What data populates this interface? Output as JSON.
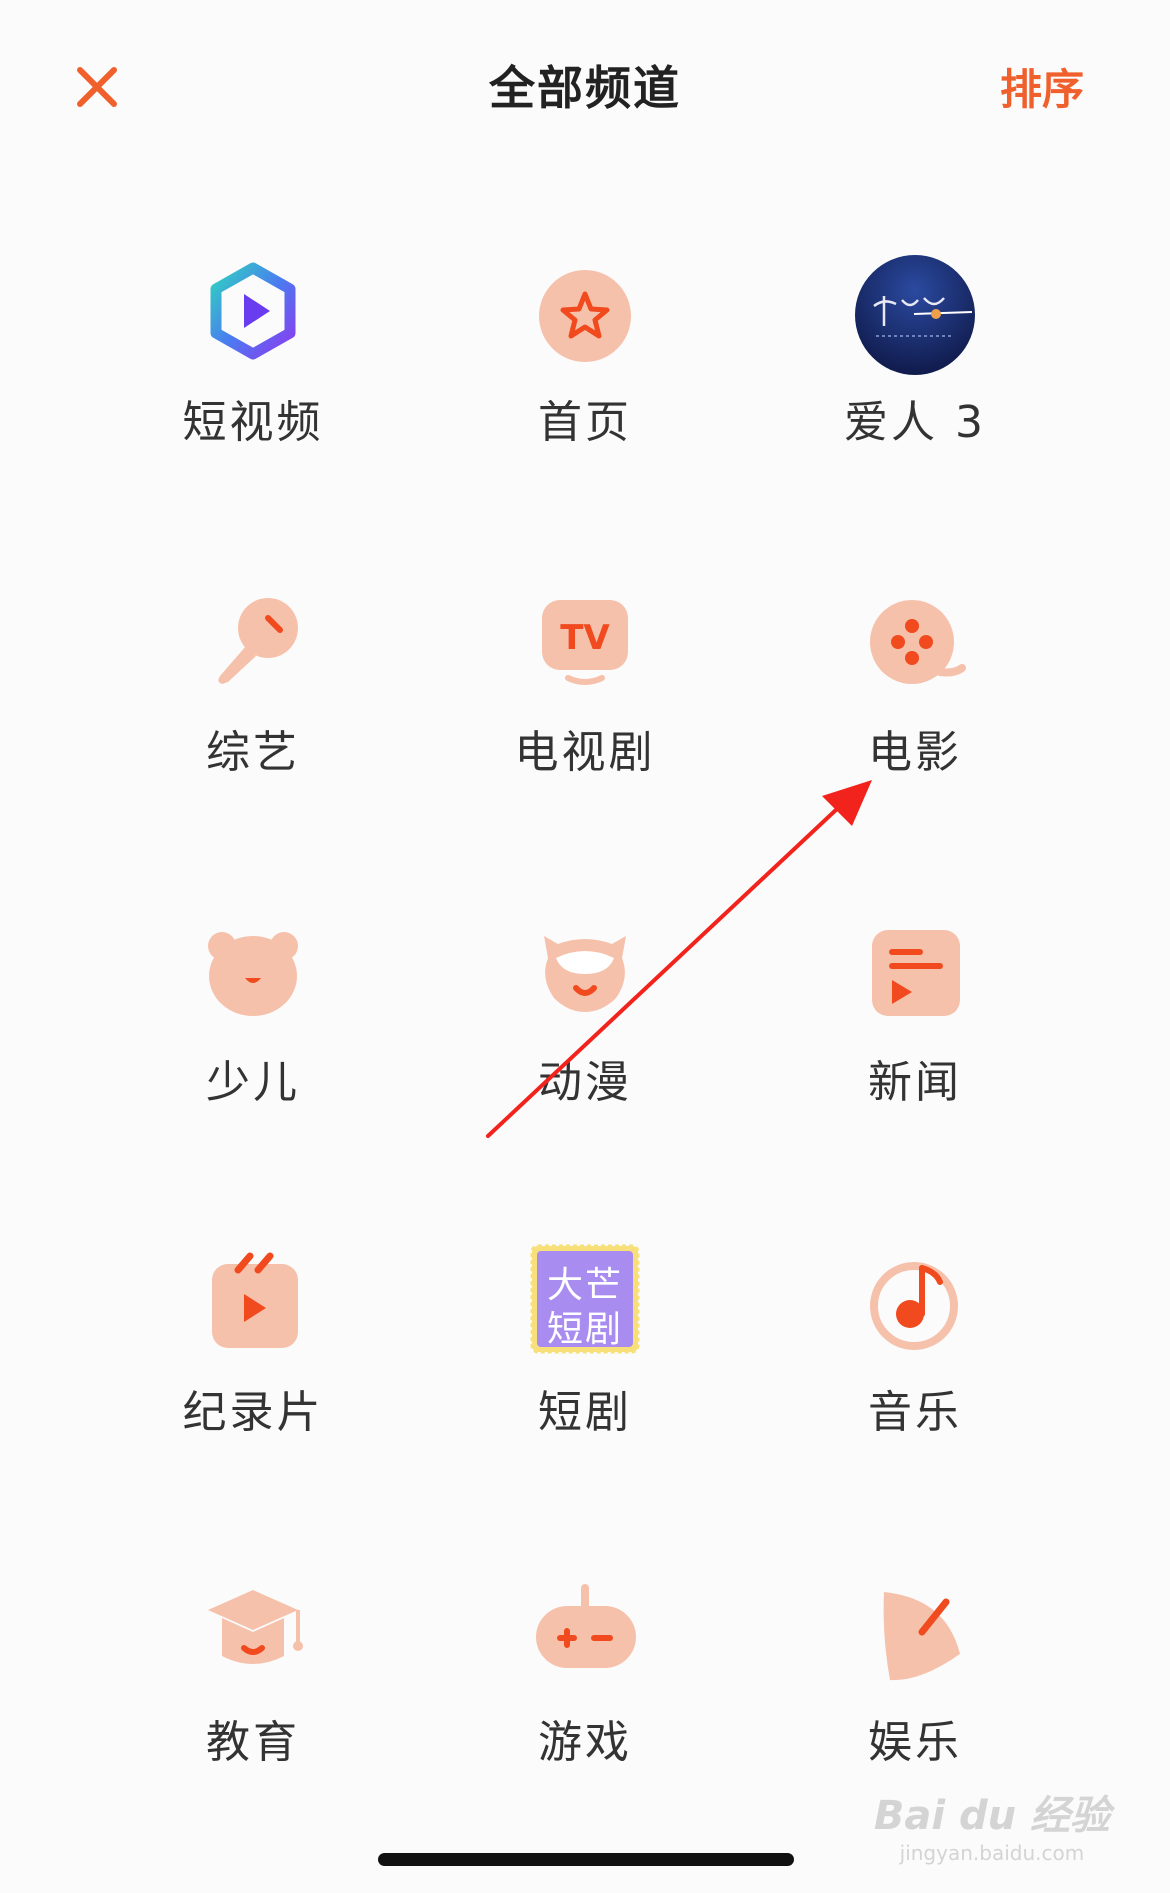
{
  "header": {
    "title": "全部频道",
    "sort_label": "排序"
  },
  "channels": [
    {
      "label": "短视频"
    },
    {
      "label": "首页"
    },
    {
      "label": "爱人 3"
    },
    {
      "label": "综艺"
    },
    {
      "label": "电视剧"
    },
    {
      "label": "电影"
    },
    {
      "label": "少儿"
    },
    {
      "label": "动漫"
    },
    {
      "label": "新闻"
    },
    {
      "label": "纪录片"
    },
    {
      "label": "短剧"
    },
    {
      "label": "音乐"
    },
    {
      "label": "教育"
    },
    {
      "label": "游戏"
    },
    {
      "label": "娱乐"
    }
  ],
  "short_drama_icon_text": {
    "line1": "大芒",
    "line2": "短剧"
  },
  "watermark": {
    "main": "Bai du 经验",
    "sub": "jingyan.baidu.com"
  },
  "colors": {
    "accent": "#f0602d",
    "icon_fill": "#f6c1aa",
    "icon_accent": "#f04a1e",
    "annotation_arrow": "#f2231c",
    "short_drama_purple": "#a98cf0"
  }
}
